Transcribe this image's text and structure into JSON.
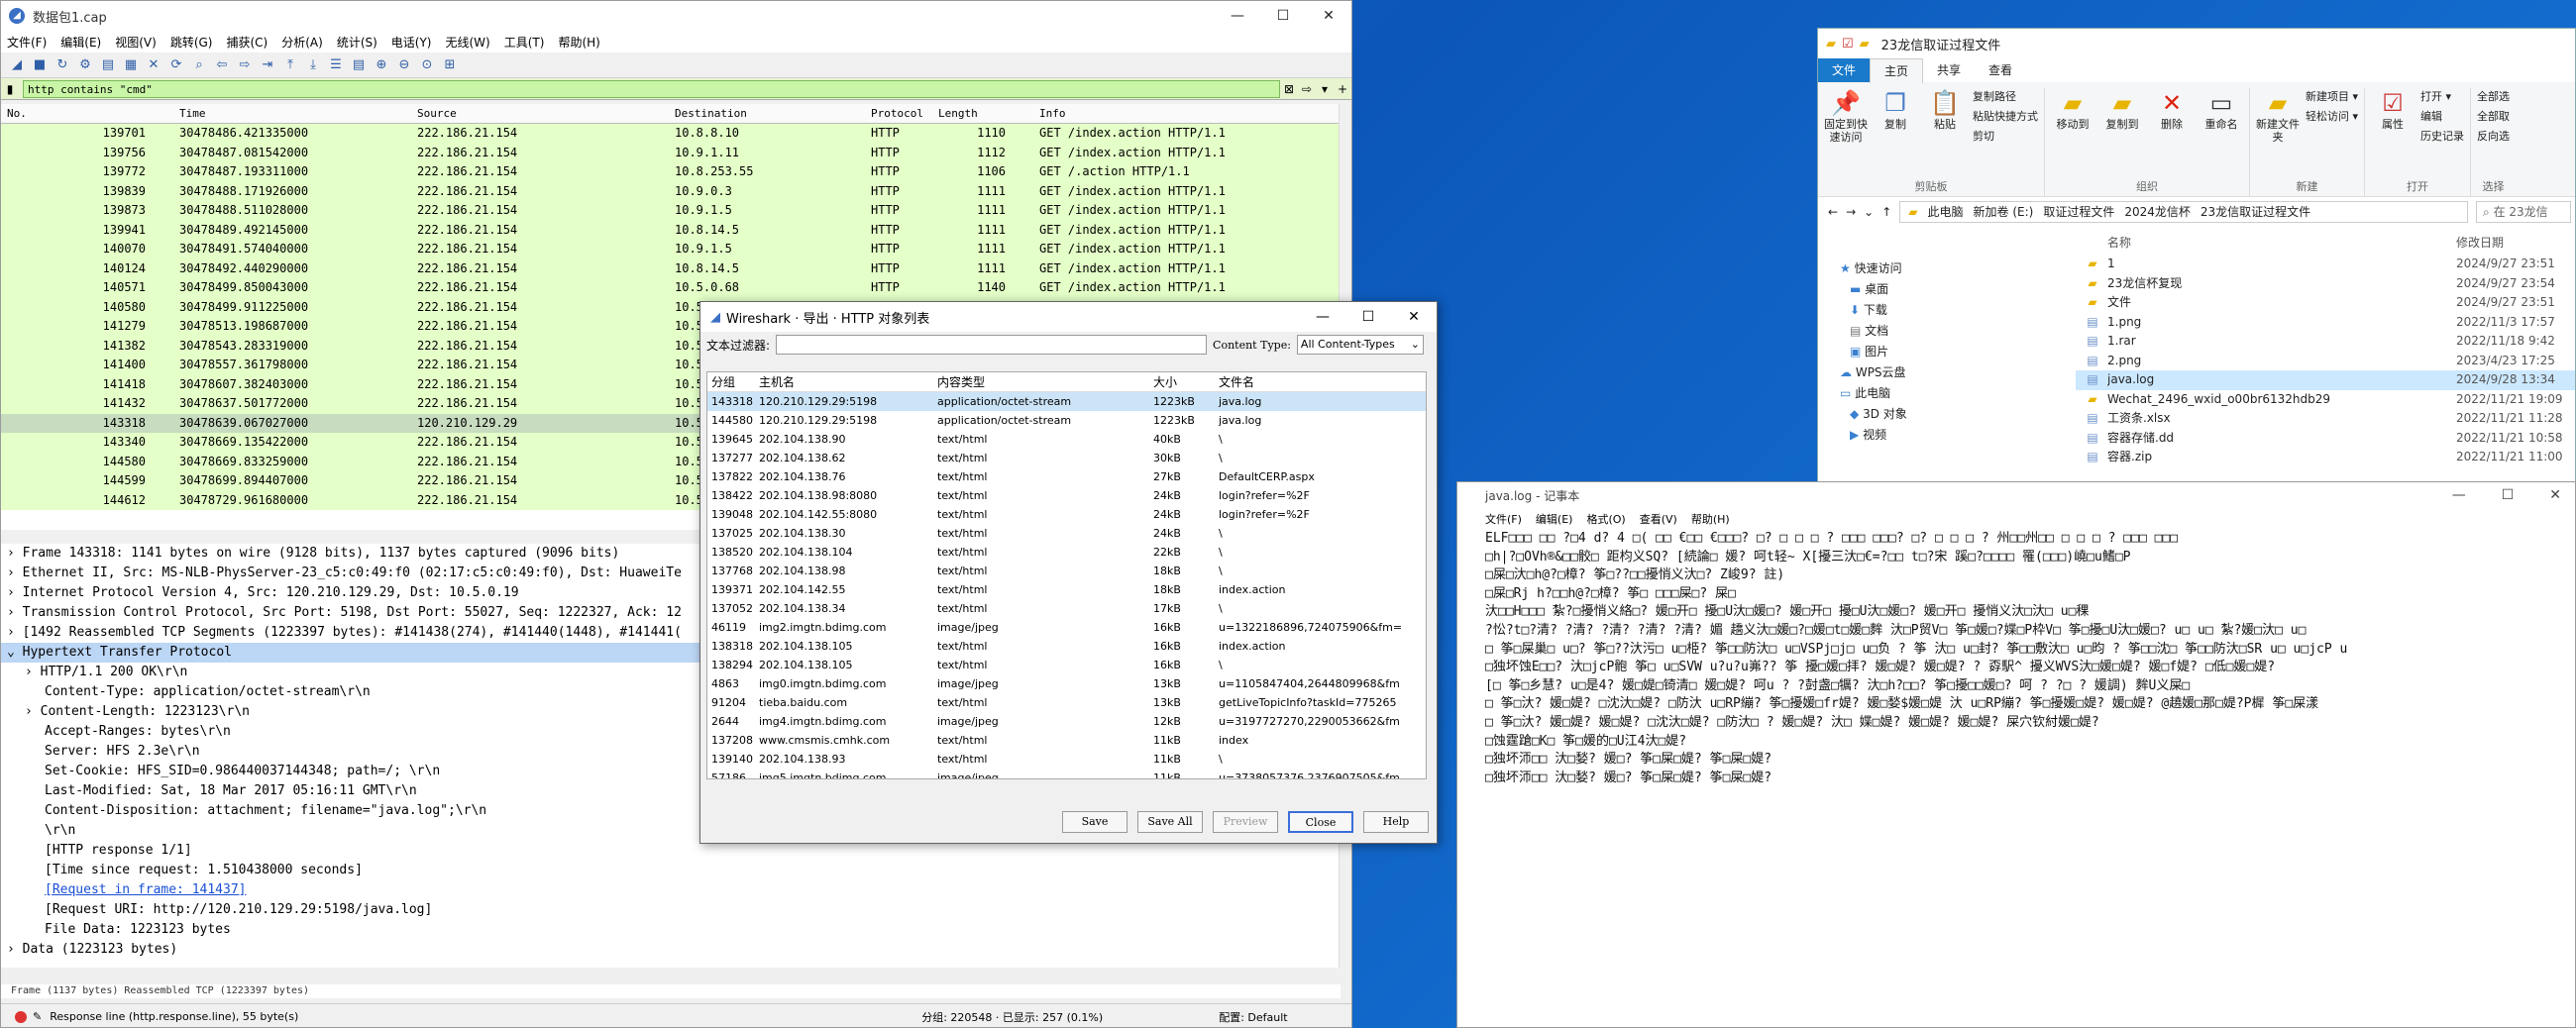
{
  "wireshark": {
    "title": "数据包1.cap",
    "window_buttons": [
      "—",
      "☐",
      "✕"
    ],
    "menu": [
      "文件(F)",
      "编辑(E)",
      "视图(V)",
      "跳转(G)",
      "捕获(C)",
      "分析(A)",
      "统计(S)",
      "电话(Y)",
      "无线(W)",
      "工具(T)",
      "帮助(H)"
    ],
    "filter": "http contains \"cmd\"",
    "columns": [
      "No.",
      "Time",
      "Source",
      "Destination",
      "Protocol",
      "Length",
      "Info"
    ],
    "packets": [
      [
        "139701",
        "30478486.421335000",
        "222.186.21.154",
        "10.8.8.10",
        "HTTP",
        "1110",
        "GET /index.action HTTP/1.1"
      ],
      [
        "139756",
        "30478487.081542000",
        "222.186.21.154",
        "10.9.1.11",
        "HTTP",
        "1112",
        "GET /index.action HTTP/1.1"
      ],
      [
        "139772",
        "30478487.193311000",
        "222.186.21.154",
        "10.8.253.55",
        "HTTP",
        "1106",
        "GET /.action HTTP/1.1"
      ],
      [
        "139839",
        "30478488.171926000",
        "222.186.21.154",
        "10.9.0.3",
        "HTTP",
        "1111",
        "GET /index.action HTTP/1.1"
      ],
      [
        "139873",
        "30478488.511028000",
        "222.186.21.154",
        "10.9.1.5",
        "HTTP",
        "1111",
        "GET /index.action HTTP/1.1"
      ],
      [
        "139941",
        "30478489.492145000",
        "222.186.21.154",
        "10.8.14.5",
        "HTTP",
        "1111",
        "GET /index.action HTTP/1.1"
      ],
      [
        "140070",
        "30478491.574040000",
        "222.186.21.154",
        "10.9.1.5",
        "HTTP",
        "1111",
        "GET /index.action HTTP/1.1"
      ],
      [
        "140124",
        "30478492.440290000",
        "222.186.21.154",
        "10.8.14.5",
        "HTTP",
        "1111",
        "GET /index.action HTTP/1.1"
      ],
      [
        "140571",
        "30478499.850043000",
        "222.186.21.154",
        "10.5.0.68",
        "HTTP",
        "1140",
        "GET /index.action HTTP/1.1"
      ],
      [
        "140580",
        "30478499.911225000",
        "222.186.21.154",
        "10.5",
        "",
        "",
        ""
      ],
      [
        "141279",
        "30478513.198687000",
        "222.186.21.154",
        "10.5",
        "",
        "",
        ""
      ],
      [
        "141382",
        "30478543.283319000",
        "222.186.21.154",
        "10.5",
        "",
        "",
        ""
      ],
      [
        "141400",
        "30478557.361798000",
        "222.186.21.154",
        "10.5",
        "",
        "",
        ""
      ],
      [
        "141418",
        "30478607.382403000",
        "222.186.21.154",
        "10.5",
        "",
        "",
        ""
      ],
      [
        "141432",
        "30478637.501772000",
        "222.186.21.154",
        "10.5",
        "",
        "",
        ""
      ],
      [
        "143318",
        "30478639.067027000",
        "120.210.129.29",
        "10.5",
        "",
        "",
        ""
      ],
      [
        "143340",
        "30478669.135422000",
        "222.186.21.154",
        "10.5",
        "",
        "",
        ""
      ],
      [
        "144580",
        "30478669.833259000",
        "222.186.21.154",
        "10.5",
        "",
        "",
        ""
      ],
      [
        "144599",
        "30478699.894407000",
        "222.186.21.154",
        "10.5",
        "",
        "",
        ""
      ],
      [
        "144612",
        "30478729.961680000",
        "222.186.21.154",
        "10.5",
        "",
        "",
        ""
      ]
    ],
    "details": [
      "Frame 143318: 1141 bytes on wire (9128 bits), 1137 bytes captured (9096 bits)",
      "Ethernet II, Src: MS-NLB-PhysServer-23_c5:c0:49:f0 (02:17:c5:c0:49:f0), Dst: HuaweiTe",
      "Internet Protocol Version 4, Src: 120.210.129.29, Dst: 10.5.0.19",
      "Transmission Control Protocol, Src Port: 5198, Dst Port: 55027, Seq: 1222327, Ack: 12",
      "[1492 Reassembled TCP Segments (1223397 bytes): #141438(274), #141440(1448), #141441(",
      "Hypertext Transfer Protocol",
      "HTTP/1.1 200 OK\\r\\n",
      "Content-Type: application/octet-stream\\r\\n",
      "Content-Length: 1223123\\r\\n",
      "Accept-Ranges: bytes\\r\\n",
      "Server: HFS 2.3e\\r\\n",
      "Set-Cookie: HFS_SID=0.986440037144348; path=/; \\r\\n",
      "Last-Modified: Sat, 18 Mar 2017 05:16:11 GMT\\r\\n",
      "Content-Disposition: attachment; filename=\"java.log\";\\r\\n",
      "\\r\\n",
      "[HTTP response 1/1]",
      "[Time since request: 1.510438000 seconds]",
      "[Request in frame: 141437]",
      "[Request URI: http://120.210.129.29:5198/java.log]",
      "File Data: 1223123 bytes",
      "Data (1223123 bytes)"
    ],
    "bytes_tabs": "Frame (1137 bytes)    Reassembled TCP (1223397 bytes)",
    "status_left": "Response line (http.response.line), 55 byte(s)",
    "status_mid": "分组: 220548 · 已显示: 257 (0.1%)",
    "status_right": "配置: Default"
  },
  "dialog": {
    "title": "Wireshark · 导出 · HTTP 对象列表",
    "filter_label": "文本过滤器:",
    "content_type_label": "Content Type:",
    "content_type_value": "All Content-Types",
    "columns": [
      "分组",
      "主机名",
      "内容类型",
      "大小",
      "文件名"
    ],
    "rows": [
      [
        "143318",
        "120.210.129.29:5198",
        "application/octet-stream",
        "1223kB",
        "java.log"
      ],
      [
        "144580",
        "120.210.129.29:5198",
        "application/octet-stream",
        "1223kB",
        "java.log"
      ],
      [
        "139645",
        "202.104.138.90",
        "text/html",
        "40kB",
        "\\"
      ],
      [
        "137277",
        "202.104.138.62",
        "text/html",
        "30kB",
        "\\"
      ],
      [
        "137822",
        "202.104.138.76",
        "text/html",
        "27kB",
        "DefaultCERP.aspx"
      ],
      [
        "138422",
        "202.104.138.98:8080",
        "text/html",
        "24kB",
        "login?refer=%2F"
      ],
      [
        "139048",
        "202.104.142.55:8080",
        "text/html",
        "24kB",
        "login?refer=%2F"
      ],
      [
        "137025",
        "202.104.138.30",
        "text/html",
        "24kB",
        "\\"
      ],
      [
        "138520",
        "202.104.138.104",
        "text/html",
        "22kB",
        "\\"
      ],
      [
        "137768",
        "202.104.138.98",
        "text/html",
        "18kB",
        "\\"
      ],
      [
        "139371",
        "202.104.142.55",
        "text/html",
        "18kB",
        "index.action"
      ],
      [
        "137052",
        "202.104.138.34",
        "text/html",
        "17kB",
        "\\"
      ],
      [
        "46119",
        "img2.imgtn.bdimg.com",
        "image/jpeg",
        "16kB",
        "u=1322186896,724075906&fm="
      ],
      [
        "138318",
        "202.104.138.105",
        "text/html",
        "16kB",
        "index.action"
      ],
      [
        "138294",
        "202.104.138.105",
        "text/html",
        "16kB",
        "\\"
      ],
      [
        "4863",
        "img0.imgtn.bdimg.com",
        "image/jpeg",
        "13kB",
        "u=1105847404,2644809968&fm"
      ],
      [
        "91204",
        "tieba.baidu.com",
        "text/html",
        "13kB",
        "getLiveTopicInfo?taskId=775265"
      ],
      [
        "2644",
        "img4.imgtn.bdimg.com",
        "image/jpeg",
        "12kB",
        "u=3197727270,2290053662&fm"
      ],
      [
        "137208",
        "www.cmsmis.cmhk.com",
        "text/html",
        "11kB",
        "index"
      ],
      [
        "139140",
        "202.104.138.93",
        "text/html",
        "11kB",
        "\\"
      ],
      [
        "57186",
        "img5.imgtn.bdimg.com",
        "image/jpeg",
        "11kB",
        "u=3738057376,2376907505&fm"
      ]
    ],
    "buttons": [
      "Save",
      "Save All",
      "Preview",
      "Close",
      "Help"
    ]
  },
  "explorer": {
    "title": "23龙信取证过程文件",
    "tabs": [
      "文件",
      "主页",
      "共享",
      "查看"
    ],
    "ribbon_groups": [
      {
        "name": "剪贴板",
        "big": [
          "固定到快速访问",
          "复制",
          "粘贴"
        ],
        "small": [
          "复制路径",
          "粘贴快捷方式",
          "剪切"
        ]
      },
      {
        "name": "组织",
        "big": [
          "移动到",
          "复制到",
          "删除",
          "重命名"
        ],
        "small": []
      },
      {
        "name": "新建",
        "big": [
          "新建文件夹"
        ],
        "small": [
          "新建项目 ▾",
          "轻松访问 ▾"
        ]
      },
      {
        "name": "打开",
        "big": [
          "属性"
        ],
        "small": [
          "打开 ▾",
          "编辑",
          "历史记录"
        ]
      },
      {
        "name": "选择",
        "big": [],
        "small": [
          "全部选",
          "全部取",
          "反向选"
        ]
      }
    ],
    "breadcrumb": [
      "此电脑",
      "新加卷 (E:)",
      "取证过程文件",
      "2024龙信杯",
      "23龙信取证过程文件"
    ],
    "search_placeholder": "在 23龙信",
    "nav": [
      "快速访问",
      "桌面",
      "下载",
      "文档",
      "图片",
      "WPS云盘",
      "此电脑",
      "3D 对象",
      "视频"
    ],
    "col_name": "名称",
    "col_date": "修改日期",
    "files": [
      [
        "1",
        "2024/9/27 23:51"
      ],
      [
        "23龙信杯复现",
        "2024/9/27 23:54"
      ],
      [
        "文件",
        "2024/9/27 23:51"
      ],
      [
        "1.png",
        "2022/11/3 17:57"
      ],
      [
        "1.rar",
        "2022/11/18 9:42"
      ],
      [
        "2.png",
        "2023/4/23 17:25"
      ],
      [
        "java.log",
        "2024/9/28 13:34"
      ],
      [
        "Wechat_2496_wxid_o00br6132hdb29",
        "2022/11/21 19:09"
      ],
      [
        "工资条.xlsx",
        "2022/11/21 11:28"
      ],
      [
        "容器存储.dd",
        "2022/11/21 10:58"
      ],
      [
        "容器.zip",
        "2022/11/21 11:00"
      ]
    ]
  },
  "notepad": {
    "title": "java.log - 记事本",
    "menu": [
      "文件(F)",
      "编辑(E)",
      "格式(O)",
      "查看(V)",
      "帮助(H)"
    ],
    "lines": [
      "ELF□□□   □□  ?□4 d?  4 □( □□   €□□ €□□□? □? □  □ □ ? □□□ □□□? □? □ □ □ ? 州□□州□□ □ □ □ ? □□□ □□□",
      "□h|?□OVh®&□□骹□ 距枃义SQ?  [続論□ 媛?   呵t轻~  X[擾三汏□€=?□□ t□?宋 蹊□?□□□□   罹(□□□)嶢□u鰭□P",
      "□屎□汏□h@?□樟? 筝□??□□擾悄义汏□?  Z峻9? 註)",
      "□屎□Rj h?□□h@?□樟? 筝□  □□□屎□? 屎□",
      "汏□□H□□□  紮?□擾悄义絡□?   媛□开□  擾□U汏□媛□?   媛□开□  擾□U汏□媛□?  媛□开□  擾悄义汏□汏□  u□稞",
      "?忪?t□?清? ?清? ?清? ?清? ?清?  媚  趫义汏□媛□?□媛□t□媛□麰  汏□P贸V□ 筝□媛□?媟□P枠V□ 筝□擾□U汏□媛□? u□  u□  紮?媛□汏□  u□",
      "□ 筝□屎巢□  u□?  筝□??汏污□  u□栕? 筝□□防汏□  u□VSPj□j□  u□负 ? 筝 汏□  u□封? 筝□□敷汏□  u□昀 ? 筝□□沈□  筝□□防汏□SR  u□ u□jcP  u",
      "□独坏蚀E□□?  汏□jcP骲 筝□  u□SVW  u?u?u岪??  筝 擾□媛□拝?  媛□媞?  媛□媞?   ?  孬駅^ 擾义WVS汏□媛□媞?  媛□f媞?  □低□媛□媞?",
      "[□ 筝□乡慧?  u□是4?  媛□媞□锜清□  媛□媞?  呵u     ?  ?尌盏□犡?   汏□h?□□?  筝□擾□□媛□?  呵   ?   ?□ ?  媛調)  麰U义屎□",
      "□ 筝□汏?  媛□媞?  □沈汏□媞?  □防汏  u□RP繃? 筝□擾媛□fr媞?  媛□媝$媛□媞 汏  u□RP繃? 筝□擾媛□媞?  媛□媞?  @趬媛□那□媞?P樨  筝□屎漾",
      "□ 筝□汏?  媛□媞?  媛□媞?  □沈汏□媞?  □防汏□ ?  媛□媞?  汏□  媟□媞?  媛□媞?  媛□媞?  屎穴钦紂媛□媞?",
      "□蚀霆蹌□K□  筝□媛的□U江4汏□媞?",
      "□独坏沞□□  汏□媝?  媛□?  筝□屎□媞?  筝□屎□媞?",
      "□独坏沞□□  汏□媝?  媛□?  筝□屎□媞?  筝□屎□媞?"
    ]
  }
}
